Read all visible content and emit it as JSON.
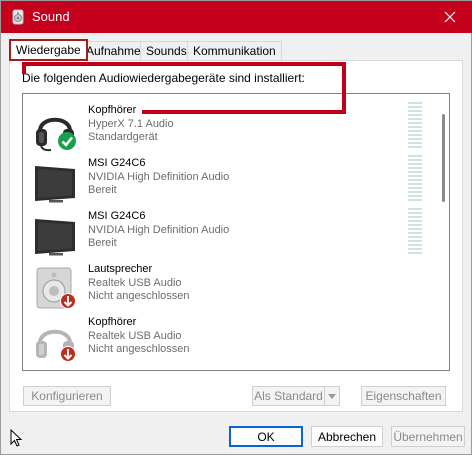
{
  "window": {
    "title": "Sound",
    "accent_color": "#c4001d",
    "close_icon": "close-icon"
  },
  "tabs": [
    {
      "label": "Wiedergabe",
      "active": true
    },
    {
      "label": "Aufnahme",
      "active": false
    },
    {
      "label": "Sounds",
      "active": false
    },
    {
      "label": "Kommunikation",
      "active": false
    }
  ],
  "playback": {
    "intro": "Die folgenden Audiowiedergabegeräte sind installiert:",
    "devices": [
      {
        "name": "Kopfhörer",
        "driver": "HyperX 7.1 Audio",
        "status": "Standardgerät",
        "icon": "headset-icon",
        "badge": "default-check-icon"
      },
      {
        "name": "MSI G24C6",
        "driver": "NVIDIA High Definition Audio",
        "status": "Bereit",
        "icon": "monitor-icon",
        "badge": ""
      },
      {
        "name": "MSI G24C6",
        "driver": "NVIDIA High Definition Audio",
        "status": "Bereit",
        "icon": "monitor-icon",
        "badge": ""
      },
      {
        "name": "Lautsprecher",
        "driver": "Realtek USB Audio",
        "status": "Nicht angeschlossen",
        "icon": "speaker-icon",
        "badge": "disconnected-icon"
      },
      {
        "name": "Kopfhörer",
        "driver": "Realtek USB Audio",
        "status": "Nicht angeschlossen",
        "icon": "headset-icon",
        "badge": "disconnected-icon"
      }
    ]
  },
  "buttons": {
    "configure": "Konfigurieren",
    "set_default": "Als Standard",
    "properties": "Eigenschaften",
    "ok": "OK",
    "cancel": "Abbrechen",
    "apply": "Übernehmen"
  }
}
